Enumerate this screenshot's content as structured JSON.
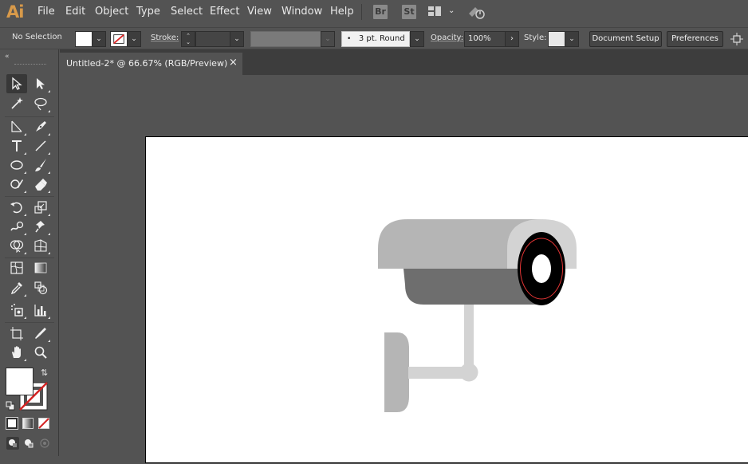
{
  "app": {
    "logo": "Ai",
    "accent": "#d89a4a"
  },
  "menu": {
    "items": [
      "File",
      "Edit",
      "Object",
      "Type",
      "Select",
      "Effect",
      "View",
      "Window",
      "Help"
    ]
  },
  "menubar_icons": {
    "bridge": "Br",
    "stock": "St",
    "workspace": "workspace-switcher-icon",
    "gpu": "gpu-performance-icon"
  },
  "control": {
    "selection": "No Selection",
    "fill_color": "#ffffff",
    "stroke_color": "none",
    "stroke_label": "Stroke:",
    "stroke_weight": "",
    "brush": "3 pt. Round",
    "opacity_label": "Opacity:",
    "opacity_value": "100%",
    "style_label": "Style:",
    "document_setup": "Document Setup",
    "preferences": "Preferences"
  },
  "document": {
    "tab_title": "Untitled-2* @ 66.67% (RGB/Preview)",
    "close": "×"
  },
  "tools": {
    "fill_color": "#ffffff",
    "stroke_color": "none",
    "names": [
      "selection",
      "direct-selection",
      "magic-wand",
      "lasso",
      "pen",
      "curvature",
      "type",
      "line-segment",
      "ellipse",
      "paintbrush",
      "shaper",
      "eraser",
      "rotate",
      "scale",
      "warp",
      "puppet-warp",
      "shape-builder",
      "perspective-grid",
      "mesh",
      "gradient",
      "eyedropper",
      "blend",
      "symbol-sprayer",
      "column-graph",
      "artboard",
      "slice",
      "hand",
      "zoom"
    ]
  },
  "artwork": {
    "camera_body_color": "#b5b5b5",
    "camera_shadow_color": "#6e6e6e",
    "lens_rim_color": "#d3d3d3",
    "lens_color": "#000000",
    "lens_ring_color": "#e53535",
    "mount_color": "#d3d3d3",
    "wall_plate_color": "#b5b5b5"
  }
}
